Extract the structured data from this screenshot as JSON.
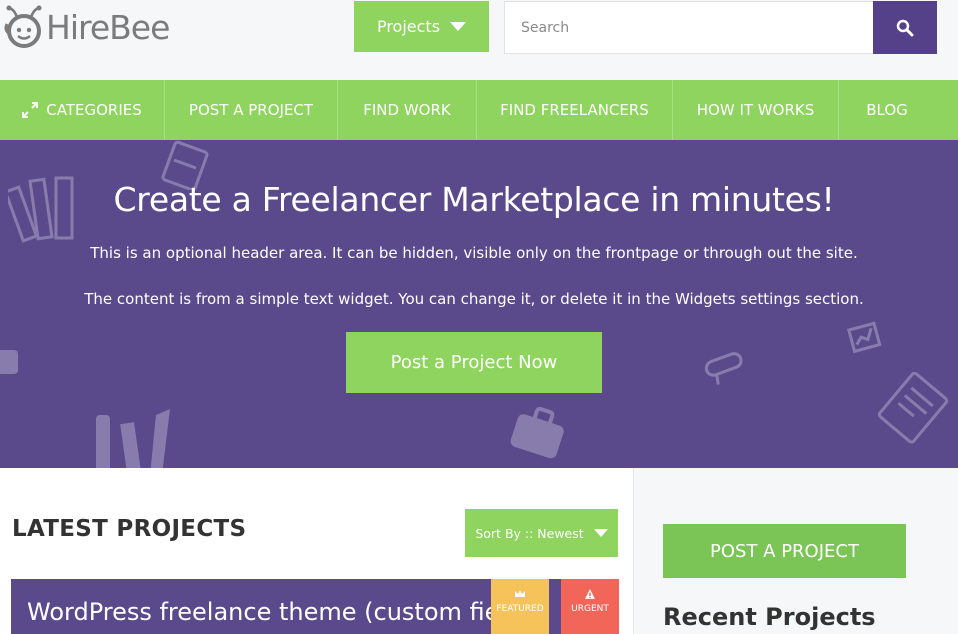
{
  "brand": {
    "logo_text": "HireBee"
  },
  "header": {
    "projects_button": "Projects",
    "search_placeholder": "Search"
  },
  "nav": {
    "items": [
      {
        "label": "CATEGORIES"
      },
      {
        "label": "POST A PROJECT"
      },
      {
        "label": "FIND WORK"
      },
      {
        "label": "FIND FREELANCERS"
      },
      {
        "label": "HOW IT WORKS"
      },
      {
        "label": "BLOG"
      }
    ]
  },
  "hero": {
    "title": "Create a Freelancer Marketplace in minutes!",
    "line1": "This is an optional header area. It can be hidden, visible only on the frontpage or through out the site.",
    "line2": "The content is from a simple text widget. You can change it, or delete it in the Widgets settings section.",
    "cta": "Post a Project Now"
  },
  "main": {
    "section_title": "LATEST PROJECTS",
    "sort_label": "Sort By :: Newest",
    "project": {
      "title": "WordPress freelance theme (custom fields)",
      "badges": {
        "featured": "FEATURED",
        "urgent": "URGENT"
      }
    }
  },
  "sidebar": {
    "post_button": "POST A PROJECT",
    "recent_title": "Recent Projects"
  },
  "colors": {
    "green": "#8ed45e",
    "purple": "#5a4a8c",
    "dark_purple": "#55418a",
    "featured": "#f6c35b",
    "urgent": "#f2665a"
  },
  "icons": [
    "bee-logo-icon",
    "caret-down-icon",
    "search-icon",
    "expand-arrows-icon",
    "crown-icon",
    "warning-icon"
  ]
}
